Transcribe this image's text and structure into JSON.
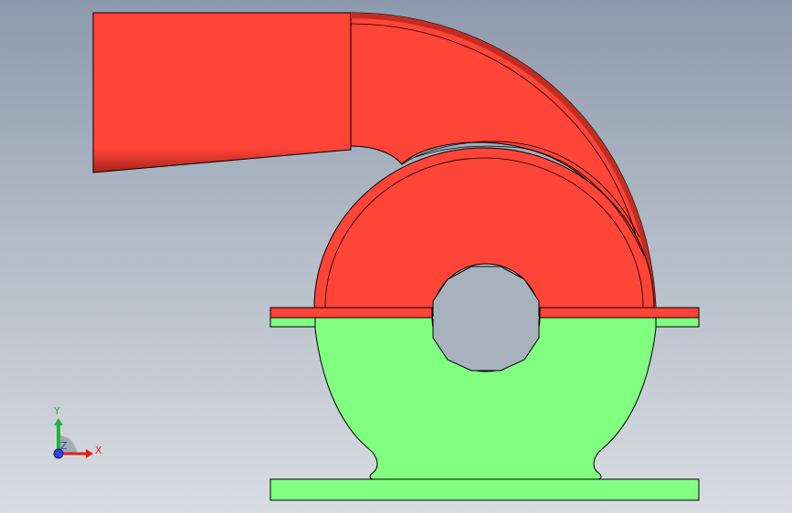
{
  "viewport": {
    "background_top": "#8d9aad",
    "background_bottom": "#d9dde2"
  },
  "model": {
    "upper_casing_color": "#ff4438",
    "upper_casing_shadow": "#b0271e",
    "lower_casing_color": "#80ff80",
    "edge_color": "#000000"
  },
  "triad": {
    "x_label": "X",
    "y_label": "Y",
    "z_label": "Z",
    "x_color": "#e0201c",
    "y_color": "#22b43a",
    "z_color": "#2846d8"
  }
}
